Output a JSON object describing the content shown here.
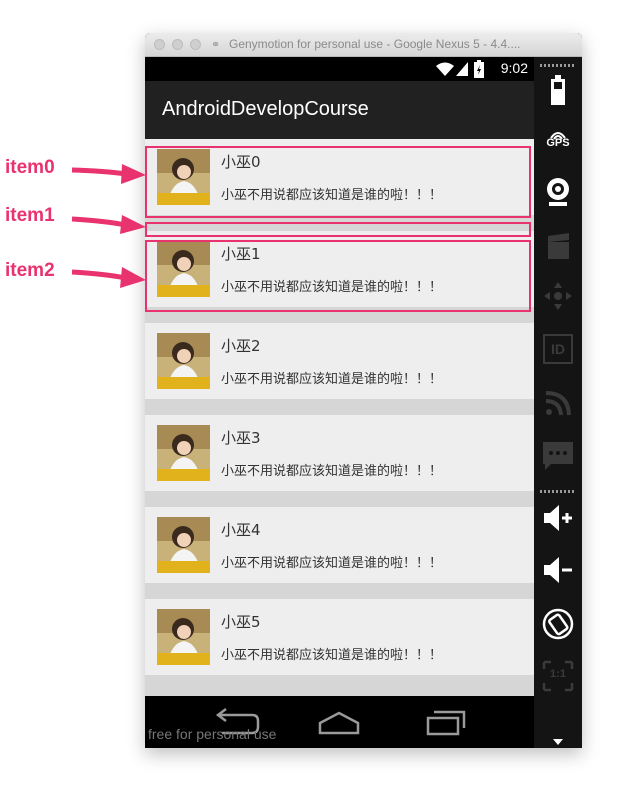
{
  "window": {
    "title": "Genymotion for personal use - Google Nexus 5 - 4.4...."
  },
  "status_bar": {
    "time": "9:02"
  },
  "app": {
    "title": "AndroidDevelopCourse"
  },
  "list_items": [
    {
      "title": "小巫0",
      "desc": "小巫不用说都应该知道是谁的啦！！！"
    },
    {
      "title": "小巫1",
      "desc": "小巫不用说都应该知道是谁的啦！！！"
    },
    {
      "title": "小巫2",
      "desc": "小巫不用说都应该知道是谁的啦！！！"
    },
    {
      "title": "小巫3",
      "desc": "小巫不用说都应该知道是谁的啦！！！"
    },
    {
      "title": "小巫4",
      "desc": "小巫不用说都应该知道是谁的啦！！！"
    },
    {
      "title": "小巫5",
      "desc": "小巫不用说都应该知道是谁的啦！！！"
    }
  ],
  "watermark": "free for personal use",
  "annotations": [
    {
      "label": "item0"
    },
    {
      "label": "item1"
    },
    {
      "label": "item2"
    }
  ],
  "sidebar": {
    "gps_label": "GPS",
    "id_label": "ID",
    "scale_label": "1:1"
  },
  "colors": {
    "annotation": "#e8336e",
    "action_bar": "#212121",
    "list_item_bg": "#eeeeee",
    "divider_bg": "#d6d6d6"
  }
}
